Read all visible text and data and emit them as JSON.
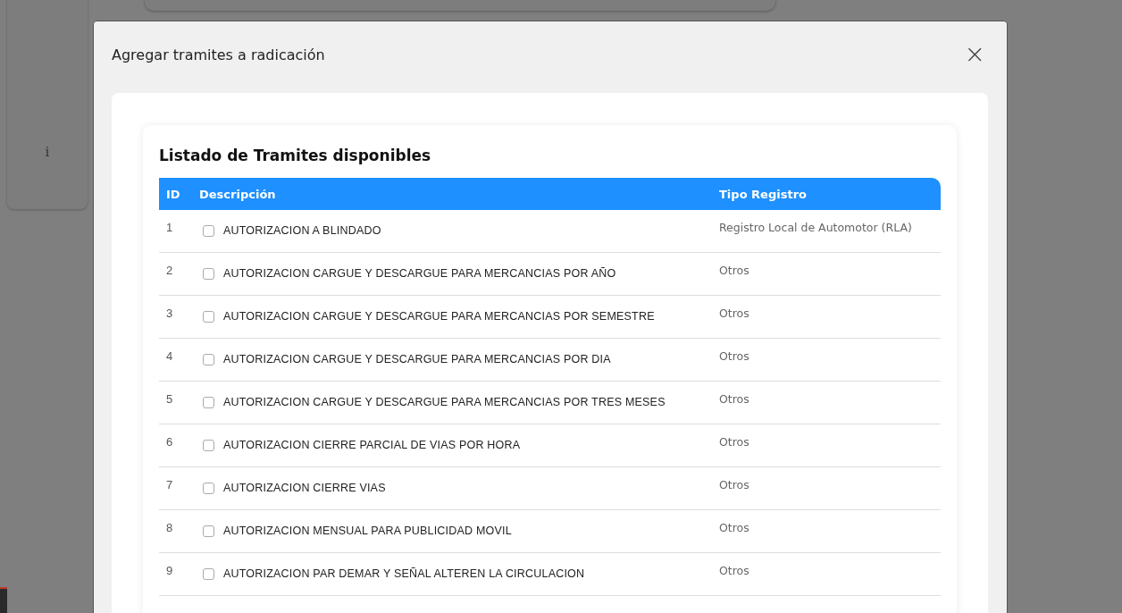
{
  "background": {
    "side_card_text": "i"
  },
  "dialog": {
    "title": "Agregar tramites a radicación",
    "close": "×"
  },
  "card": {
    "title": "Listado de Tramites disponibles"
  },
  "table": {
    "columns": [
      "ID",
      "Descripción",
      "Tipo Registro"
    ],
    "rows": [
      {
        "id": "1",
        "description": "AUTORIZACION A BLINDADO",
        "checked": false,
        "tipo": "Registro Local de Automotor (RLA)"
      },
      {
        "id": "2",
        "description": "AUTORIZACION CARGUE Y DESCARGUE PARA MERCANCIAS POR AÑO",
        "checked": false,
        "tipo": "Otros"
      },
      {
        "id": "3",
        "description": "AUTORIZACION CARGUE Y DESCARGUE PARA MERCANCIAS POR SEMESTRE",
        "checked": false,
        "tipo": "Otros"
      },
      {
        "id": "4",
        "description": "AUTORIZACION CARGUE Y DESCARGUE PARA MERCANCIAS POR DIA",
        "checked": false,
        "tipo": "Otros"
      },
      {
        "id": "5",
        "description": "AUTORIZACION CARGUE Y DESCARGUE PARA MERCANCIAS POR TRES MESES",
        "checked": false,
        "tipo": "Otros"
      },
      {
        "id": "6",
        "description": "AUTORIZACION CIERRE PARCIAL DE VIAS POR HORA",
        "checked": false,
        "tipo": "Otros"
      },
      {
        "id": "7",
        "description": "AUTORIZACION CIERRE VIAS",
        "checked": false,
        "tipo": "Otros"
      },
      {
        "id": "8",
        "description": "AUTORIZACION MENSUAL PARA PUBLICIDAD MOVIL",
        "checked": false,
        "tipo": "Otros"
      },
      {
        "id": "9",
        "description": "AUTORIZACION PAR DEMAR Y SEÑAL ALTEREN LA CIRCULACION",
        "checked": false,
        "tipo": "Otros"
      }
    ]
  }
}
